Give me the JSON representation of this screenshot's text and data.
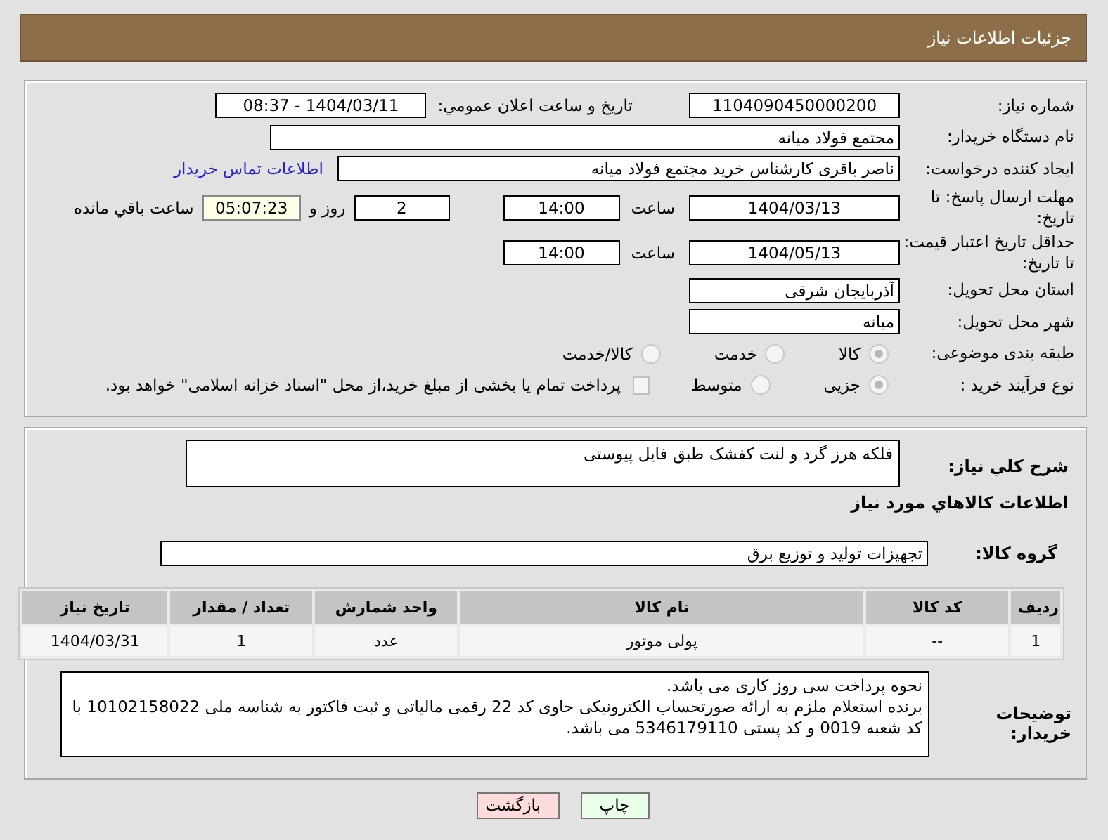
{
  "header": {
    "title": "جزئیات اطلاعات نیاز"
  },
  "need_number": {
    "label": "شماره نیاز:",
    "value": "1104090450000200"
  },
  "announce": {
    "label": "تاریخ و ساعت اعلان عمومي:",
    "value": "1404/03/11 - 08:37"
  },
  "buyer_org": {
    "label": "نام دستگاه خریدار:",
    "value": "مجتمع فولاد میانه"
  },
  "requester": {
    "label": "ایجاد کننده درخواست:",
    "value": "ناصر باقری کارشناس خرید مجتمع فولاد میانه"
  },
  "buyer_contact_link": "اطلاعات تماس خریدار",
  "reply_deadline": {
    "label": "مهلت ارسال پاسخ: تا تاریخ:",
    "date": "1404/03/13",
    "time_label": "ساعت",
    "time": "14:00",
    "days": "2",
    "days_label": "روز و",
    "remaining": "05:07:23",
    "remaining_label": "ساعت باقي مانده"
  },
  "price_validity": {
    "label": "حداقل تاریخ اعتبار قیمت: تا تاریخ:",
    "date": "1404/05/13",
    "time_label": "ساعت",
    "time": "14:00"
  },
  "province": {
    "label": "استان محل تحویل:",
    "value": "آذربایجان شرقی"
  },
  "city": {
    "label": "شهر محل تحویل:",
    "value": "میانه"
  },
  "category": {
    "label": "طبقه بندی موضوعی:",
    "options": [
      {
        "label": "کالا",
        "selected": true
      },
      {
        "label": "خدمت",
        "selected": false
      },
      {
        "label": "کالا/خدمت",
        "selected": false
      }
    ]
  },
  "process": {
    "label": "نوع فرآیند خرید :",
    "options": [
      {
        "label": "جزیی",
        "selected": true
      },
      {
        "label": "متوسط",
        "selected": false
      }
    ],
    "payment_checkbox": {
      "label": "پرداخت تمام یا بخشی از مبلغ خرید،از محل \"اسناد خزانه اسلامی\" خواهد بود.",
      "checked": false
    }
  },
  "description": {
    "label": "شرح کلي نياز:",
    "value": "فلکه هرز گرد و لنت کفشک طبق فایل پیوستی"
  },
  "goods_section_title": "اطلاعات کالاهاي مورد نياز",
  "goods_group": {
    "label": "گروه کالا:",
    "value": "تجهیزات تولید و توزیع برق"
  },
  "table": {
    "columns": [
      "ردیف",
      "کد کالا",
      "نام کالا",
      "واحد شمارش",
      "تعداد / مقدار",
      "تاریخ نیاز"
    ],
    "rows": [
      [
        "1",
        "--",
        "پولی موتور",
        "عدد",
        "1",
        "1404/03/31"
      ]
    ]
  },
  "buyer_notes": {
    "label": "توضیحات خریدار:",
    "lines": [
      "نحوه پرداخت سی روز کاری می باشد.",
      "برنده استعلام ملزم به ارائه صورتحساب الکترونیکی حاوی کد 22 رقمی مالیاتی و ثبت فاکتور به شناسه ملی 10102158022 با کد شعبه 0019 و کد پستی 5346179110 می باشد."
    ]
  },
  "buttons": [
    {
      "label": "چاپ",
      "kind": "print"
    },
    {
      "label": "بازگشت",
      "kind": "back"
    }
  ]
}
